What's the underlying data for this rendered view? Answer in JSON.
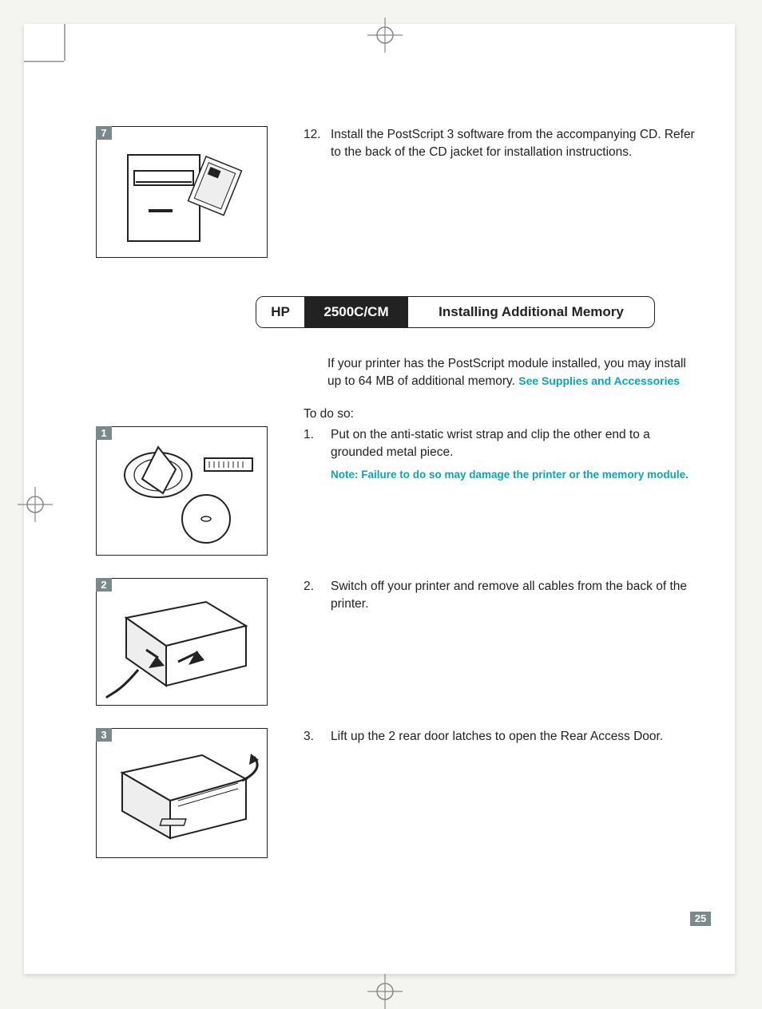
{
  "figures": {
    "fig7_label": "7",
    "fig1_label": "1",
    "fig2_label": "2",
    "fig3_label": "3"
  },
  "step12": {
    "num": "12.",
    "text": "Install the PostScript 3 software from the accompanying CD. Refer to the back of the CD jacket for installation instructions."
  },
  "banner": {
    "brand": "HP",
    "model": "2500C/CM",
    "title": "Installing Additional Memory"
  },
  "intro": {
    "text": "If your printer has the PostScript module installed, you may install up to 64 MB of additional memory. ",
    "link": "See Supplies and Accessories"
  },
  "to_do": "To do so:",
  "step1": {
    "num": "1.",
    "text": "Put on the anti-static wrist strap and clip the other end to a grounded metal piece.",
    "note": "Note: Failure to do so may damage the printer or the memory module."
  },
  "step2": {
    "num": "2.",
    "text": "Switch off your printer and remove all cables from the back of the printer."
  },
  "step3": {
    "num": "3.",
    "text": "Lift up the 2 rear door latches to open the Rear Access Door."
  },
  "page_number": "25"
}
